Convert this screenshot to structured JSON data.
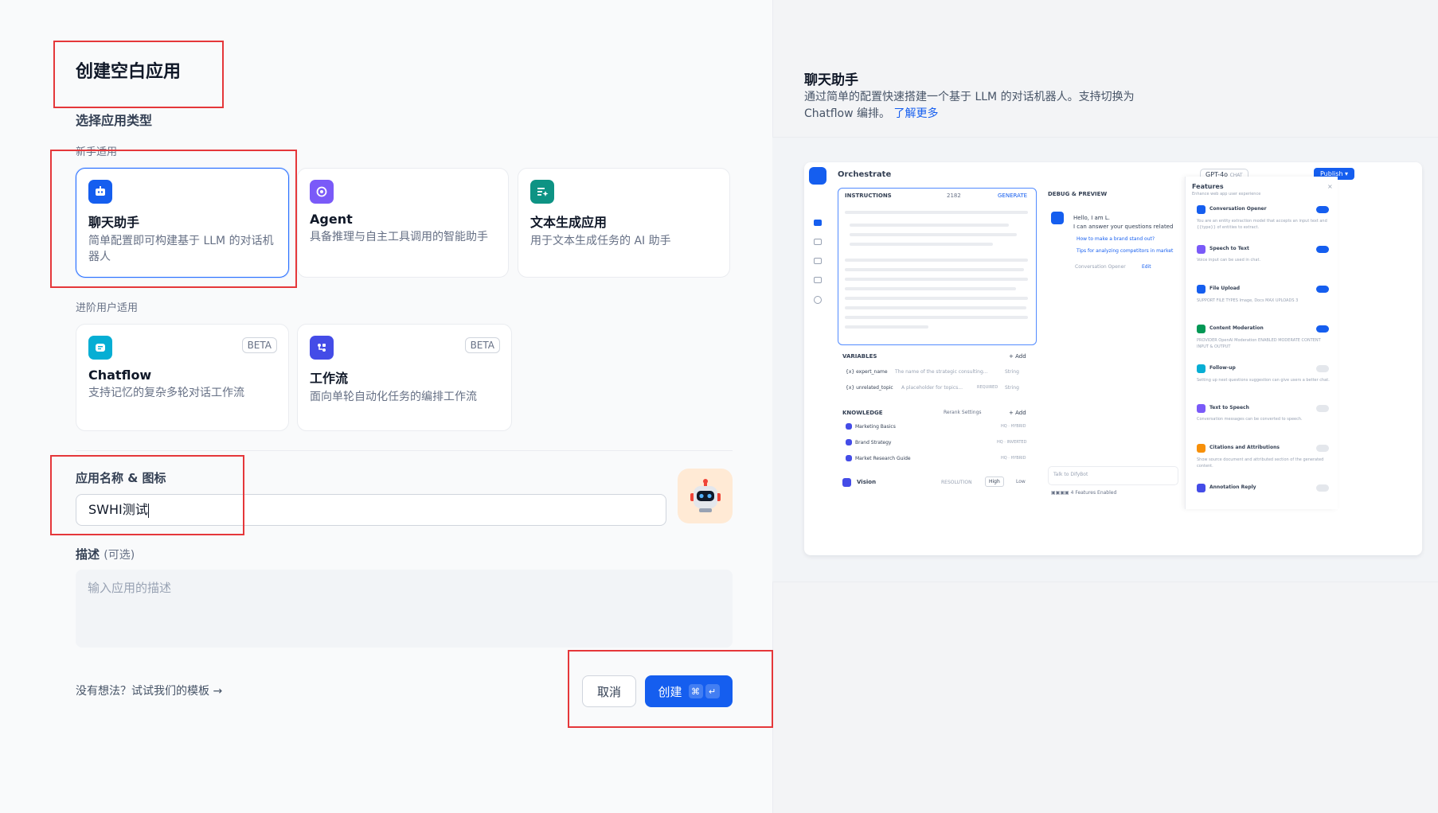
{
  "left": {
    "title": "创建空白应用",
    "choose_type_label": "选择应用类型",
    "beginner_label": "新手适用",
    "advanced_label": "进阶用户适用",
    "beginner_cards": [
      {
        "name": "聊天助手",
        "desc": "简单配置即可构建基于 LLM 的对话机器人",
        "icon": "chat-bot-icon",
        "color": "#155eef",
        "selected": true
      },
      {
        "name": "Agent",
        "desc": "具备推理与自主工具调用的智能助手",
        "icon": "agent-icon",
        "color": "#7a5af8",
        "selected": false
      },
      {
        "name": "文本生成应用",
        "desc": "用于文本生成任务的 AI 助手",
        "icon": "text-generation-icon",
        "color": "#0e9384",
        "selected": false
      }
    ],
    "advanced_cards": [
      {
        "name": "Chatflow",
        "desc": "支持记忆的复杂多轮对话工作流",
        "badge": "BETA",
        "icon": "chatflow-icon",
        "color": "#06aed4"
      },
      {
        "name": "工作流",
        "desc": "面向单轮自动化任务的编排工作流",
        "badge": "BETA",
        "icon": "workflow-icon",
        "color": "#444ce7"
      }
    ],
    "name_icon_label": "应用名称 & 图标",
    "name_value": "SWHI测试",
    "desc_label": "描述",
    "desc_optional": "(可选)",
    "desc_placeholder": "输入应用的描述",
    "template_link": "没有想法？试试我们的模板",
    "cancel_label": "取消",
    "create_label": "创建",
    "create_kbd_1": "⌘",
    "create_kbd_2": "↵"
  },
  "right": {
    "title": "聊天助手",
    "desc_1": "通过简单的配置快速搭建一个基于 LLM 的对话机器人。支持切换为",
    "desc_2": "Chatflow 编排。",
    "learn_more": "了解更多",
    "preview": {
      "orchestrate": "Orchestrate",
      "model": "GPT-4o",
      "model_tag": "CHAT",
      "publish": "Publish",
      "instructions": "INSTRUCTIONS",
      "instr_count": "2182",
      "generate": "GENERATE",
      "debug_preview": "DEBUG & PREVIEW",
      "hello_1": "Hello, I am L.",
      "hello_2": "I can answer your questions related",
      "suggest_1": "How to make a brand stand out?",
      "suggest_2": "Tips for analyzing competitors in market",
      "opener_note": "Conversation Opener",
      "edit": "Edit",
      "variables": "VARIABLES",
      "add": "+ Add",
      "vars": [
        {
          "name": "{x} expert_name",
          "desc": "The name of the strategic consulting...",
          "type": "String"
        },
        {
          "name": "{x} unrelated_topic",
          "desc": "A placeholder for topics...",
          "req": "REQUIRED",
          "type": "String"
        }
      ],
      "knowledge": "KNOWLEDGE",
      "rerank": "Rerank Settings",
      "kb": [
        {
          "name": "Marketing Basics",
          "tag": "HQ · HYBRID"
        },
        {
          "name": "Brand Strategy",
          "tag": "HQ · INVERTED"
        },
        {
          "name": "Market Research Guide",
          "tag": "HQ · HYBRID"
        }
      ],
      "vision": "Vision",
      "resolution": "RESOLUTION",
      "high": "High",
      "low": "Low",
      "talk_placeholder": "Talk to DifyBot",
      "features_enabled": "4 Features Enabled",
      "features_title": "Features",
      "features_sub": "Enhance web app user experience",
      "features": [
        {
          "name": "Conversation Opener",
          "desc": "You are an entity extraction model that accepts an input text and {{type}} of entities to extract.",
          "on": true,
          "color": "#155eef"
        },
        {
          "name": "Speech to Text",
          "desc": "Voice input can be used in chat.",
          "on": true,
          "color": "#7a5af8"
        },
        {
          "name": "File Upload",
          "desc": "SUPPORT FILE TYPES  Image, Docs   MAX UPLOADS 3",
          "on": true,
          "color": "#155eef"
        },
        {
          "name": "Content Moderation",
          "desc": "PROVIDER OpenAI Moderation   ENABLED MODERATE CONTENT INPUT & OUTPUT",
          "on": true,
          "color": "#039855"
        },
        {
          "name": "Follow-up",
          "desc": "Setting up next questions suggestion can give users a better chat.",
          "on": false,
          "color": "#06aed4"
        },
        {
          "name": "Text to Speech",
          "desc": "Conversation messages can be converted to speech.",
          "on": false,
          "color": "#7a5af8"
        },
        {
          "name": "Citations and Attributions",
          "desc": "Show source document and attributed section of the generated content.",
          "on": false,
          "color": "#f79009"
        },
        {
          "name": "Annotation Reply",
          "desc": "",
          "on": false,
          "color": "#444ce7"
        }
      ]
    }
  }
}
